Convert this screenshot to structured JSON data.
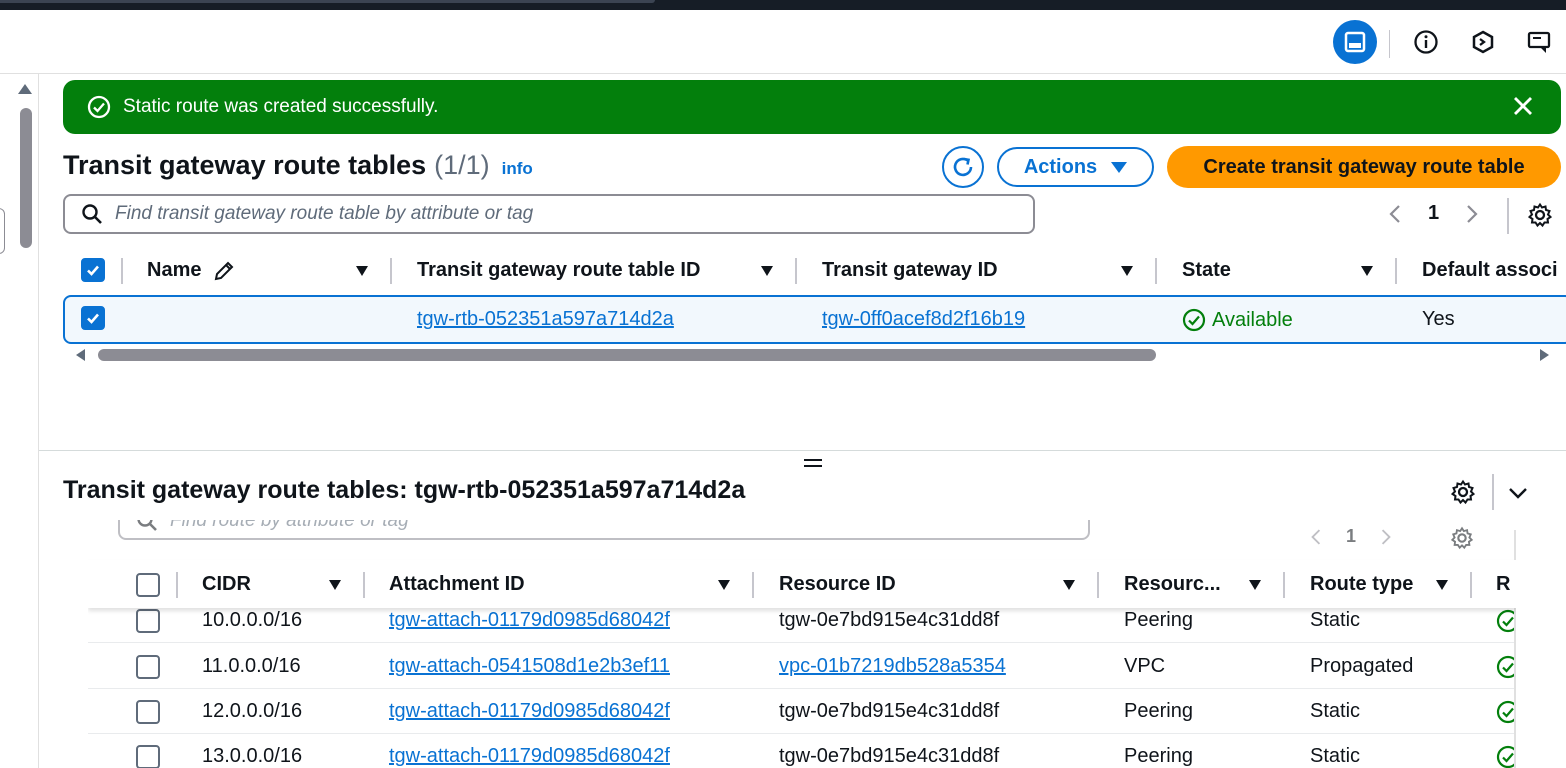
{
  "header": {
    "icons": [
      "panel-icon",
      "info-icon",
      "cloudshell-icon",
      "feedback-icon"
    ]
  },
  "flash": {
    "message": "Static route was created successfully.",
    "color": "#037f0c"
  },
  "route_tables": {
    "title": "Transit gateway route tables",
    "count": "(1/1)",
    "info_label": "info",
    "actions_label": "Actions",
    "create_label": "Create transit gateway route table",
    "search_placeholder": "Find transit gateway route table by attribute or tag",
    "page": "1",
    "columns": [
      "Name",
      "Transit gateway route table ID",
      "Transit gateway ID",
      "State",
      "Default associ"
    ],
    "rows": [
      {
        "name": "",
        "route_table_id": "tgw-rtb-052351a597a714d2a",
        "gateway_id": "tgw-0ff0acef8d2f16b19",
        "state": "Available",
        "default_association": "Yes",
        "selected": true
      }
    ]
  },
  "detail": {
    "title": "Transit gateway route tables: tgw-rtb-052351a597a714d2a",
    "search_placeholder": "Find route by attribute or tag",
    "page": "1",
    "columns": [
      "CIDR",
      "Attachment ID",
      "Resource ID",
      "Resourc...",
      "Route type",
      "R"
    ],
    "rows": [
      {
        "cidr": "10.0.0.0/16",
        "attachment_id": "tgw-attach-01179d0985d68042f",
        "resource_id": "tgw-0e7bd915e4c31dd8f",
        "resource_type": "Peering",
        "route_type": "Static"
      },
      {
        "cidr": "11.0.0.0/16",
        "attachment_id": "tgw-attach-0541508d1e2b3ef11",
        "resource_id": "vpc-01b7219db528a5354",
        "resource_type": "VPC",
        "route_type": "Propagated"
      },
      {
        "cidr": "12.0.0.0/16",
        "attachment_id": "tgw-attach-01179d0985d68042f",
        "resource_id": "tgw-0e7bd915e4c31dd8f",
        "resource_type": "Peering",
        "route_type": "Static"
      },
      {
        "cidr": "13.0.0.0/16",
        "attachment_id": "tgw-attach-01179d0985d68042f",
        "resource_id": "tgw-0e7bd915e4c31dd8f",
        "resource_type": "Peering",
        "route_type": "Static"
      }
    ]
  },
  "colors": {
    "accent": "#0972d3",
    "primary_button": "#ff9900",
    "success": "#037f0c"
  }
}
